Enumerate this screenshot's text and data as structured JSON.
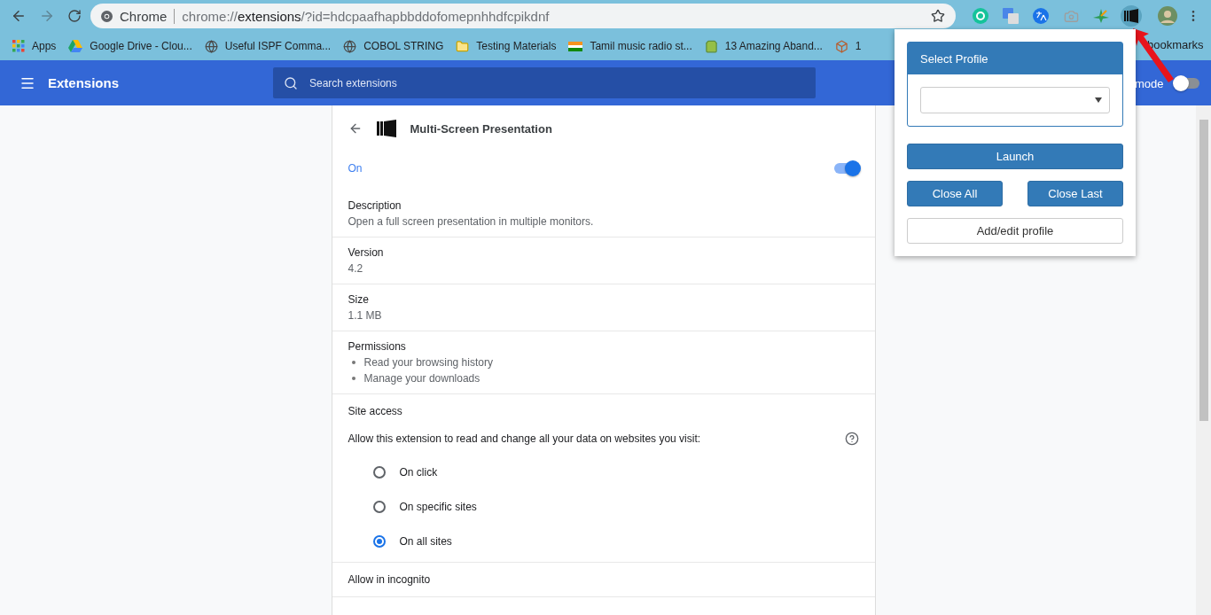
{
  "address_bar": {
    "site_label": "Chrome",
    "url_prefix": "chrome://",
    "url_host": "extensions",
    "url_rest": "/?id=hdcpaafhapbbddofomepnhhdfcpikdnf"
  },
  "toolbar_extensions": [
    {
      "kind": "grammar",
      "color": "#15c39a"
    },
    {
      "kind": "translate",
      "color": "#4a86e8"
    },
    {
      "kind": "translate-round",
      "color": "#1a73e8"
    },
    {
      "kind": "camera",
      "color": "#9e9e9e"
    },
    {
      "kind": "star",
      "color": "#2e9b57"
    },
    {
      "kind": "screens",
      "color": "#111111"
    }
  ],
  "bookmarks": [
    {
      "kind": "apps",
      "label": "Apps"
    },
    {
      "kind": "drive",
      "label": "Google Drive - Clou..."
    },
    {
      "kind": "globe",
      "label": "Useful ISPF Comma..."
    },
    {
      "kind": "globe",
      "label": "COBOL STRING"
    },
    {
      "kind": "folder",
      "label": "Testing Materials"
    },
    {
      "kind": "flag",
      "label": "Tamil music radio st..."
    },
    {
      "kind": "bag",
      "label": "13 Amazing Aband..."
    },
    {
      "kind": "cube",
      "label": "1"
    }
  ],
  "bookmarks_overflow": "bookmarks",
  "header": {
    "title": "Extensions",
    "search_placeholder": "Search extensions",
    "dev_mode_label": "mode",
    "dev_mode_on": false
  },
  "extension": {
    "name": "Multi-Screen Presentation",
    "status_label": "On",
    "enabled": true,
    "sections": [
      {
        "kind": "text",
        "title": "Description",
        "value": "Open a full screen presentation in multiple monitors."
      },
      {
        "kind": "text",
        "title": "Version",
        "value": "4.2"
      },
      {
        "kind": "text",
        "title": "Size",
        "value": "1.1 MB"
      },
      {
        "kind": "list",
        "title": "Permissions",
        "items": [
          "Read your browsing history",
          "Manage your downloads"
        ]
      }
    ],
    "site_access": {
      "title": "Site access",
      "prompt": "Allow this extension to read and change all your data on websites you visit:",
      "options": [
        {
          "label": "On click",
          "selected": false
        },
        {
          "label": "On specific sites",
          "selected": false
        },
        {
          "label": "On all sites",
          "selected": true
        }
      ]
    },
    "incognito_title": "Allow in incognito"
  },
  "popup": {
    "panel_title": "Select Profile",
    "launch": "Launch",
    "close_all": "Close All",
    "close_last": "Close Last",
    "add_edit": "Add/edit profile"
  }
}
